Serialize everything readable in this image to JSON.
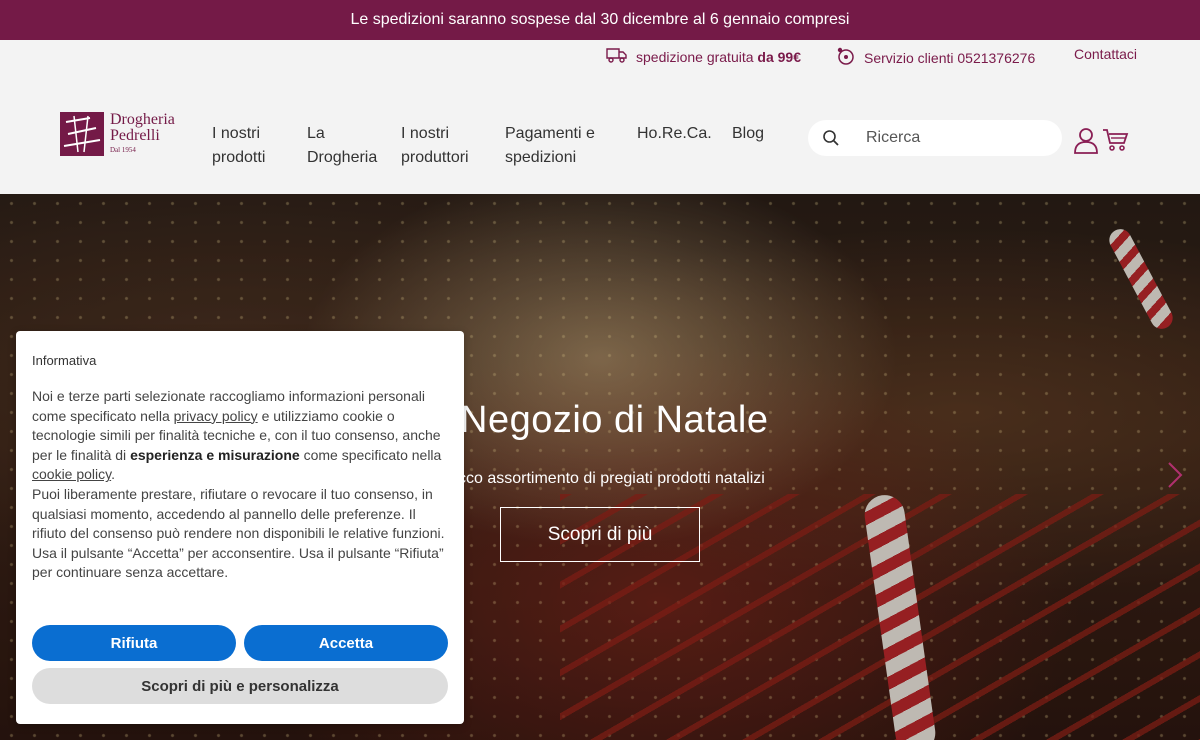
{
  "announcement": "Le spedizioni saranno sospese dal 30 dicembre al 6 gennaio compresi",
  "topbar": {
    "shipping_text": "spedizione gratuita",
    "shipping_threshold": "da 99€",
    "service_text": "Servizio clienti 0521376276",
    "contact": "Contattaci"
  },
  "logo": {
    "line1": "Drogheria",
    "line2": "Pedrelli",
    "since": "Dal 1954"
  },
  "nav": {
    "items": [
      {
        "line1": "I nostri",
        "line2": "prodotti"
      },
      {
        "line1": "La",
        "line2": "Drogheria"
      },
      {
        "line1": "I nostri",
        "line2": "produttori"
      },
      {
        "line1": "Pagamenti e",
        "line2": "spedizioni"
      },
      {
        "line1": "Ho.Re.Ca.",
        "line2": ""
      },
      {
        "line1": "Blog",
        "line2": ""
      }
    ]
  },
  "search": {
    "placeholder": "Ricerca"
  },
  "icons": {
    "truck": "truck-icon",
    "support": "customer-service-icon",
    "search": "search-icon",
    "user": "user-icon",
    "cart": "cart-icon",
    "next": "chevron-right-icon"
  },
  "hero": {
    "title": "Negozio di Natale",
    "subtitle": "cco assortimento di pregiati prodotti natalizi",
    "button": "Scopri di più"
  },
  "cookie": {
    "title": "Informativa",
    "p1_a": "Noi e terze parti selezionate raccogliamo informazioni personali come specificato nella",
    "privacy_link": "privacy policy",
    "p1_b": "e utilizziamo cookie o tecnologie simili per finalità tecniche e, con il tuo consenso, anche per le finalità di",
    "p1_bold": "esperienza e misurazione",
    "p1_c": "come specificato nella",
    "cookie_link": "cookie policy",
    "p1_end": ".",
    "p2": "Puoi liberamente prestare, rifiutare o revocare il tuo consenso, in qualsiasi momento, accedendo al pannello delle preferenze. Il rifiuto del consenso può rendere non disponibili le relative funzioni.",
    "p3": "Usa il pulsante “Accetta” per acconsentire. Usa il pulsante “Rifiuta” per continuare senza accettare.",
    "reject": "Rifiuta",
    "accept": "Accetta",
    "more": "Scopri di più e personalizza"
  },
  "colors": {
    "brand": "#741a47",
    "cookie_primary": "#0a6ed1",
    "cookie_secondary": "#dddddd"
  }
}
